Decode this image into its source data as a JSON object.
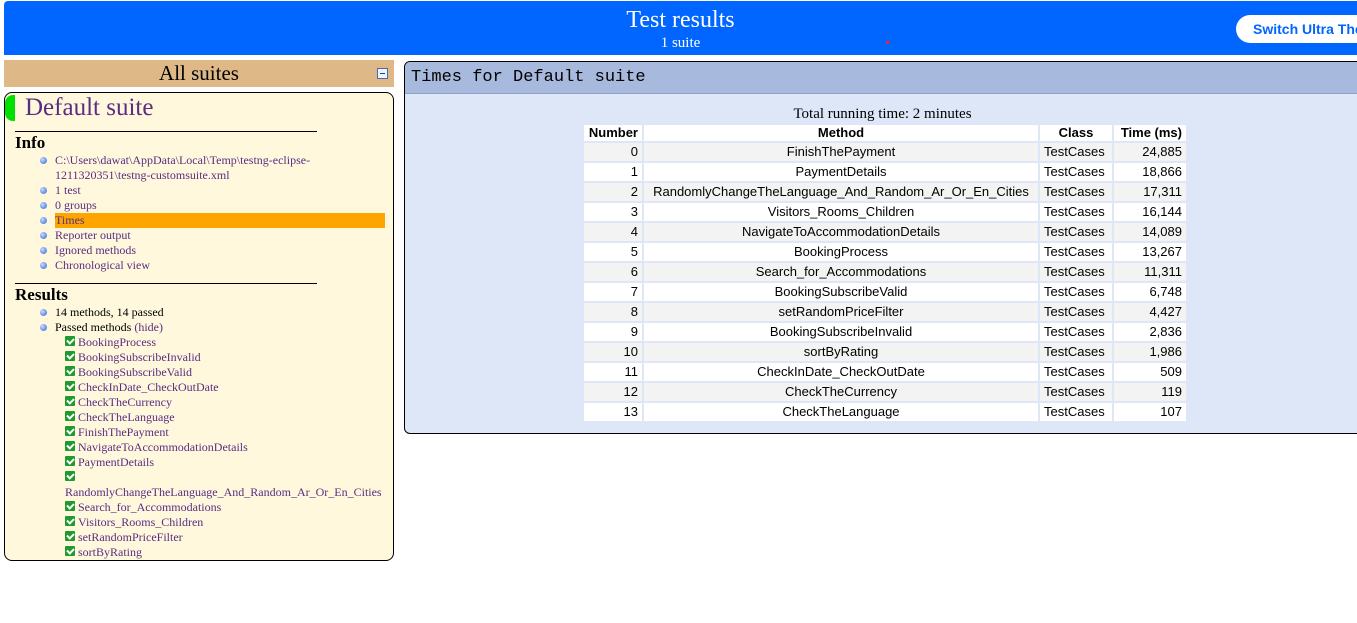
{
  "header": {
    "title": "Test results",
    "subtitle": "1 suite",
    "switch_button": "Switch Ultra Theme"
  },
  "left": {
    "suites_heading": "All suites",
    "suite_name": "Default suite",
    "info_title": "Info",
    "info_items": {
      "path": "C:\\Users\\dawat\\AppData\\Local\\Temp\\testng-eclipse-1211320351\\testng-customsuite.xml",
      "tests": "1 test",
      "groups": "0 groups",
      "times": "Times",
      "reporter": "Reporter output",
      "ignored": "Ignored methods",
      "chronological": "Chronological view"
    },
    "results_title": "Results",
    "results_summary": "14 methods, 14 passed",
    "passed_label": "Passed methods",
    "hide_link": "(hide)",
    "passed_methods": [
      "BookingProcess",
      "BookingSubscribeInvalid",
      "BookingSubscribeValid",
      "CheckInDate_CheckOutDate",
      "CheckTheCurrency",
      "CheckTheLanguage",
      "FinishThePayment",
      "NavigateToAccommodationDetails",
      "PaymentDetails",
      "RandomlyChangeTheLanguage_And_Random_Ar_Or_En_Cities",
      "Search_for_Accommodations",
      "Visitors_Rooms_Children",
      "setRandomPriceFilter",
      "sortByRating"
    ]
  },
  "right": {
    "heading": "Times for Default suite",
    "total": "Total running time: 2 minutes",
    "columns": [
      "Number",
      "Method",
      "Class",
      "Time (ms)"
    ],
    "rows": [
      [
        "0",
        "FinishThePayment",
        "TestCases",
        "24,885"
      ],
      [
        "1",
        "PaymentDetails",
        "TestCases",
        "18,866"
      ],
      [
        "2",
        "RandomlyChangeTheLanguage_And_Random_Ar_Or_En_Cities",
        "TestCases",
        "17,311"
      ],
      [
        "3",
        "Visitors_Rooms_Children",
        "TestCases",
        "16,144"
      ],
      [
        "4",
        "NavigateToAccommodationDetails",
        "TestCases",
        "14,089"
      ],
      [
        "5",
        "BookingProcess",
        "TestCases",
        "13,267"
      ],
      [
        "6",
        "Search_for_Accommodations",
        "TestCases",
        "11,311"
      ],
      [
        "7",
        "BookingSubscribeValid",
        "TestCases",
        "6,748"
      ],
      [
        "8",
        "setRandomPriceFilter",
        "TestCases",
        "4,427"
      ],
      [
        "9",
        "BookingSubscribeInvalid",
        "TestCases",
        "2,836"
      ],
      [
        "10",
        "sortByRating",
        "TestCases",
        "1,986"
      ],
      [
        "11",
        "CheckInDate_CheckOutDate",
        "TestCases",
        "509"
      ],
      [
        "12",
        "CheckTheCurrency",
        "TestCases",
        "119"
      ],
      [
        "13",
        "CheckTheLanguage",
        "TestCases",
        "107"
      ]
    ]
  },
  "colors": {
    "header_bg": "#0066ff",
    "suite_head_bg": "#deb887",
    "suite_box_bg": "#fff8dc",
    "selected_bg": "#ffa500",
    "right_head_bg": "#a7b9dd",
    "right_bg": "#dde7f8",
    "link_color": "#5a2d82",
    "pass_green": "#1f9a2f"
  }
}
